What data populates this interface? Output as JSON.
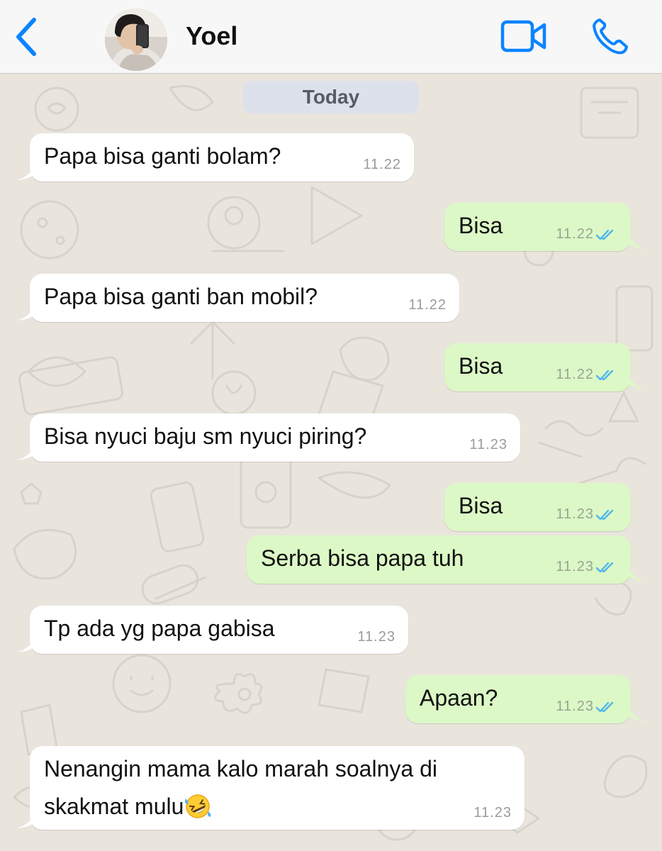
{
  "header": {
    "contact_name": "Yoel"
  },
  "chat": {
    "date_label": "Today",
    "messages": [
      {
        "direction": "incoming",
        "text": "Papa bisa ganti bolam?",
        "time": "11.22"
      },
      {
        "direction": "outgoing",
        "text": "Bisa",
        "time": "11.22",
        "status": "read"
      },
      {
        "direction": "incoming",
        "text": "Papa bisa ganti ban mobil?",
        "time": "11.22"
      },
      {
        "direction": "outgoing",
        "text": "Bisa",
        "time": "11.22",
        "status": "read"
      },
      {
        "direction": "incoming",
        "text": "Bisa nyuci baju sm nyuci piring?",
        "time": "11.23"
      },
      {
        "direction": "outgoing",
        "text": "Bisa",
        "time": "11.23",
        "status": "read"
      },
      {
        "direction": "outgoing",
        "text": "Serba bisa papa tuh",
        "time": "11.23",
        "status": "read"
      },
      {
        "direction": "incoming",
        "text": "Tp ada yg papa gabisa",
        "time": "11.23"
      },
      {
        "direction": "outgoing",
        "text": "Apaan?",
        "time": "11.23",
        "status": "read"
      },
      {
        "direction": "incoming",
        "text_line1": "Nenangin mama kalo marah soalnya di",
        "text_line2": "skakmat mulu",
        "emoji": "rolling-on-floor-laughing",
        "time": "11.23"
      }
    ]
  },
  "colors": {
    "accent": "#0a84ff",
    "incoming_bubble": "#ffffff",
    "outgoing_bubble": "#dcf8c6",
    "read_ticks": "#4fb6ec",
    "wallpaper": "#e9e5dd"
  },
  "icons": [
    "chevron-left-icon",
    "video-camera-icon",
    "phone-icon",
    "double-check-icon",
    "rofl-emoji-icon"
  ]
}
